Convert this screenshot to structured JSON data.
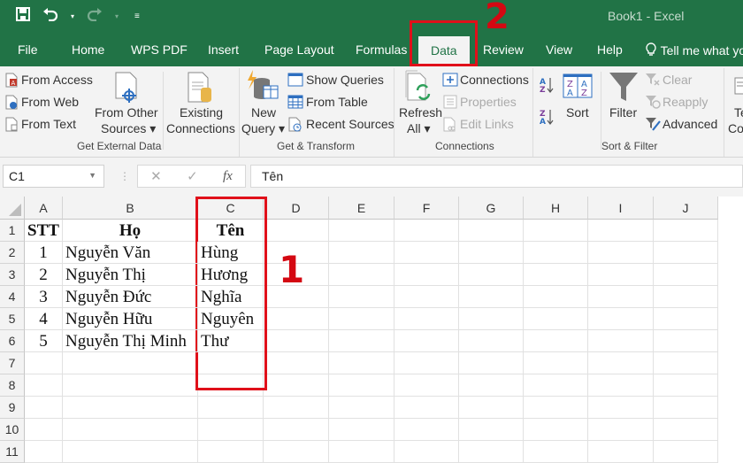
{
  "window": {
    "title": "Book1  -  Excel"
  },
  "qat": {
    "save_icon": "save-icon",
    "undo_icon": "undo-icon",
    "redo_icon": "redo-icon",
    "customize_icon": "customize-qat-icon"
  },
  "tabs": [
    {
      "label": "File"
    },
    {
      "label": "Home"
    },
    {
      "label": "WPS PDF"
    },
    {
      "label": "Insert"
    },
    {
      "label": "Page Layout"
    },
    {
      "label": "Formulas"
    },
    {
      "label": "Data",
      "active": true
    },
    {
      "label": "Review"
    },
    {
      "label": "View"
    },
    {
      "label": "Help"
    }
  ],
  "tell_me": "Tell me what yo",
  "ribbon": {
    "get_external": {
      "from_access": "From Access",
      "from_web": "From Web",
      "from_text": "From Text",
      "from_other_1": "From Other",
      "from_other_2": "Sources ▾",
      "existing_1": "Existing",
      "existing_2": "Connections",
      "group": "Get External Data"
    },
    "get_transform": {
      "new_query_1": "New",
      "new_query_2": "Query ▾",
      "show_queries": "Show Queries",
      "from_table": "From Table",
      "recent_sources": "Recent Sources",
      "group": "Get & Transform"
    },
    "connections": {
      "refresh_1": "Refresh",
      "refresh_2": "All ▾",
      "connections": "Connections",
      "properties": "Properties",
      "edit_links": "Edit Links",
      "group": "Connections"
    },
    "sort_filter": {
      "sort": "Sort",
      "filter": "Filter",
      "clear": "Clear",
      "reapply": "Reapply",
      "advanced": "Advanced",
      "group": "Sort & Filter"
    },
    "cut_off": {
      "line1": "Te",
      "line2": "Co"
    }
  },
  "formula_bar": {
    "name_box": "C1",
    "cancel": "✕",
    "enter": "✓",
    "fx": "fx",
    "content": "Tên"
  },
  "sheet": {
    "columns": [
      "A",
      "B",
      "C",
      "D",
      "E",
      "F",
      "G",
      "H",
      "I",
      "J"
    ],
    "rows": [
      "1",
      "2",
      "3",
      "4",
      "5",
      "6",
      "7",
      "8",
      "9",
      "10",
      "11"
    ],
    "data": [
      [
        "STT",
        "Họ",
        "Tên"
      ],
      [
        "1",
        "Nguyễn Văn",
        "Hùng"
      ],
      [
        "2",
        "Nguyễn Thị",
        "Hương"
      ],
      [
        "3",
        "Nguyễn Đức",
        "Nghĩa"
      ],
      [
        "4",
        "Nguyễn Hữu",
        "Nguyên"
      ],
      [
        "5",
        "Nguyễn Thị Minh",
        "Thư"
      ]
    ]
  },
  "annotations": {
    "step1": "1",
    "step2": "2",
    "color": "#e0101a"
  }
}
